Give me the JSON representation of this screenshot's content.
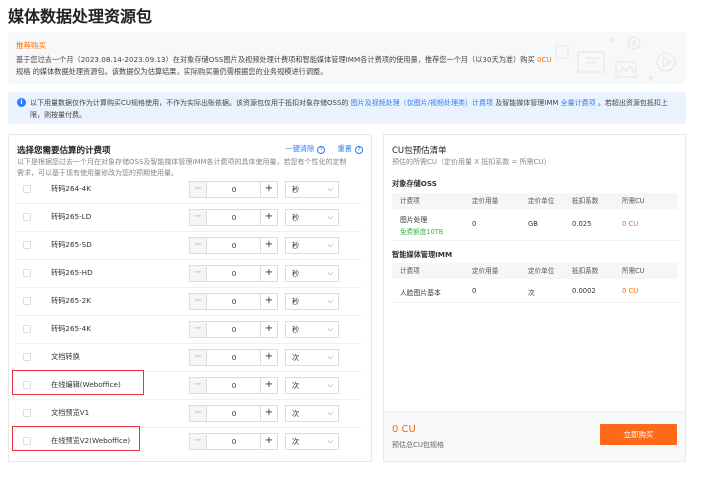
{
  "page": {
    "title": "媒体数据处理资源包"
  },
  "recommend": {
    "title": "推荐购买",
    "text_1": "基于您过去一个月（2023.08.14-2023.09.13）在对象存储OSS图片及视频处理计费项和智能媒体管理IMM各计费项的使用量，推荐您一个月（以30天为准）购买",
    "amount": "0CU",
    "text_2": "规格",
    "text_3": "的媒体数据处理资源包。该数据仅为估算结果，实际购买量仍需根据您的业务规模进行调整。"
  },
  "notice": {
    "icon": "info-icon",
    "text_1": "以下用量数据仅作为计算购买CU规格使用，不作为实际出账依据。该资源包仅用于抵扣对象存储OSS的",
    "link_1": "图片及视频处理（仅图片/视频处理类）计费项",
    "text_2": "及智能媒体管理IMM",
    "link_2": "全量计费项",
    "text_3": "。若超出资源包抵扣上限，则按量付费。"
  },
  "left": {
    "title": "选择您需要估算的计费项",
    "clear": "一键清除",
    "reset": "重置",
    "desc": "以下是根据您过去一个月在对象存储OSS及智能媒体管理IMM各计费项的具体使用量，若您有个性化的定制需求，可以基于现有使用量修改为您的预期使用量。",
    "rows": [
      {
        "label": "转码264-4K",
        "value": "0",
        "unit": "秒"
      },
      {
        "label": "转码265-LD",
        "value": "0",
        "unit": "秒"
      },
      {
        "label": "转码265-SD",
        "value": "0",
        "unit": "秒"
      },
      {
        "label": "转码265-HD",
        "value": "0",
        "unit": "秒"
      },
      {
        "label": "转码265-2K",
        "value": "0",
        "unit": "秒"
      },
      {
        "label": "转码265-4K",
        "value": "0",
        "unit": "秒"
      },
      {
        "label": "文档转换",
        "value": "0",
        "unit": "次"
      },
      {
        "label": "在线编辑(Weboffice)",
        "value": "0",
        "unit": "次"
      },
      {
        "label": "文档预览V1",
        "value": "0",
        "unit": "次"
      },
      {
        "label": "在线预览V2(Weboffice)",
        "value": "0",
        "unit": "次"
      }
    ]
  },
  "right": {
    "title": "CU包预估清单",
    "subtitle": "预估的所需CU（定价用量 X 抵扣系数 = 所需CU）",
    "headers": [
      "计费项",
      "定价用量",
      "定价单位",
      "抵扣系数",
      "所需CU"
    ],
    "oss": {
      "title": "对象存储OSS",
      "item": "图片处理",
      "free": "免费额度10TB",
      "usage": "0",
      "unit": "GB",
      "coef": "0.025",
      "cu": "0 CU"
    },
    "imm": {
      "title": "智能媒体管理IMM",
      "item": "人脸图片基本",
      "usage": "0",
      "unit": "次",
      "coef": "0.0002",
      "cu": "0 CU"
    },
    "total": "0 CU",
    "total_label": "预估总CU包规格",
    "buy": "立即购买"
  },
  "colors": {
    "accent": "#ff6a00",
    "link": "#2d7bf4",
    "highlight": "#e0333c"
  }
}
